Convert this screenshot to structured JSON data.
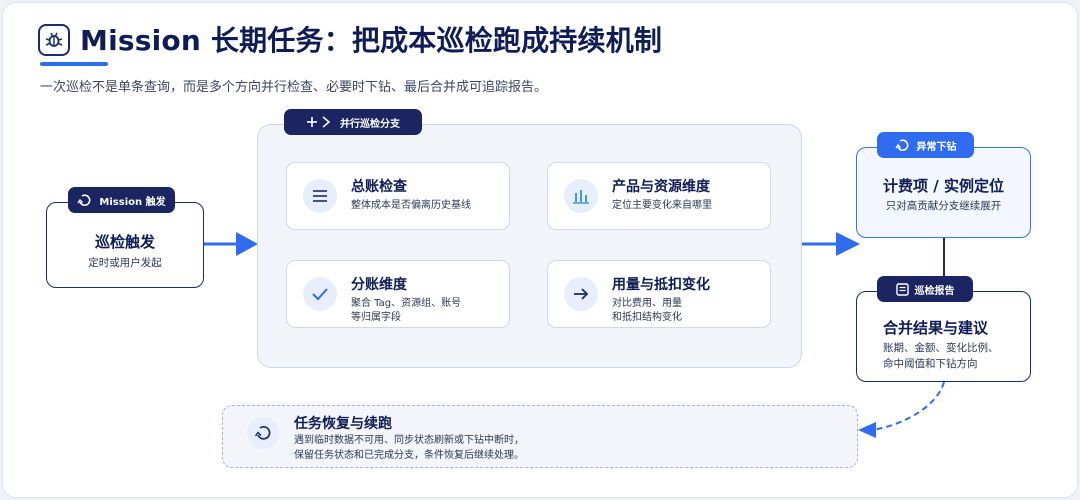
{
  "header": {
    "title": "Mission 长期任务：把成本巡检跑成持续机制",
    "subtitle": "一次巡检不是单条查询，而是多个方向并行检查、必要时下钻、最后合并成可追踪报告。"
  },
  "trigger": {
    "badge": "Mission 触发",
    "title": "巡检触发",
    "desc": "定时或用户发起"
  },
  "parallel": {
    "badge": "并行巡检分支",
    "cards": [
      {
        "title": "总账检查",
        "desc": [
          "整体成本是否偏离历史基线"
        ],
        "icon": "list-icon"
      },
      {
        "title": "产品与资源维度",
        "desc": [
          "定位主要变化来自哪里"
        ],
        "icon": "bar-chart-icon"
      },
      {
        "title": "分账维度",
        "desc": [
          "聚合 Tag、资源组、账号",
          "等归属字段"
        ],
        "icon": "check-icon"
      },
      {
        "title": "用量与抵扣变化",
        "desc": [
          "对比费用、用量",
          "和抵扣结构变化"
        ],
        "icon": "arrow-right-icon"
      }
    ]
  },
  "drilldown": {
    "badge": "异常下钻",
    "title": "计费项 / 实例定位",
    "desc": "只对高贡献分支继续展开"
  },
  "report": {
    "badge": "巡检报告",
    "title": "合并结果与建议",
    "desc": [
      "账期、金额、变化比例、",
      "命中阈值和下钻方向"
    ]
  },
  "resume": {
    "title": "任务恢复与续跑",
    "desc": [
      "遇到临时数据不可用、同步状态刷新或下钻中断时，",
      "保留任务状态和已完成分支，条件恢复后继续处理。"
    ]
  },
  "colors": {
    "navy": "#1a2562",
    "accent": "#2f6cf0"
  }
}
